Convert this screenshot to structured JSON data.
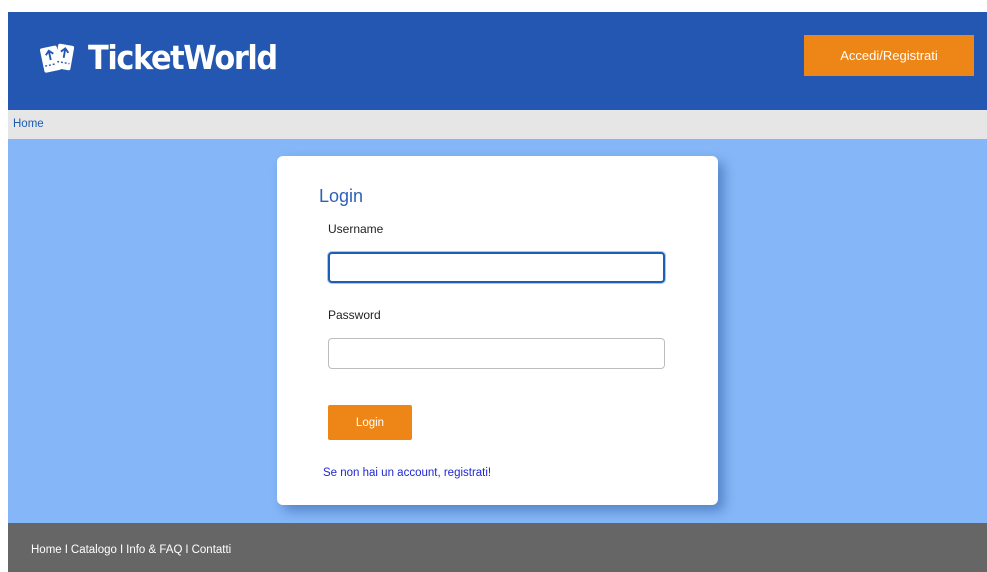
{
  "header": {
    "brand": "TicketWorld",
    "logo_icon": "tickets-icon",
    "auth_button": "Accedi/Registrati"
  },
  "breadcrumb": {
    "home": "Home"
  },
  "login_form": {
    "title": "Login",
    "username_label": "Username",
    "username_value": "",
    "password_label": "Password",
    "password_value": "",
    "submit_label": "Login",
    "register_link": "Se non hai un account, registrati!"
  },
  "footer": {
    "links": [
      "Home",
      "Catalogo",
      "Info & FAQ",
      "Contatti"
    ],
    "separator": "I"
  },
  "colors": {
    "header_bg": "#2457b1",
    "accent_orange": "#ed8517",
    "main_bg": "#85b7f8",
    "footer_bg": "#666666",
    "link_blue": "#1f27d4"
  }
}
